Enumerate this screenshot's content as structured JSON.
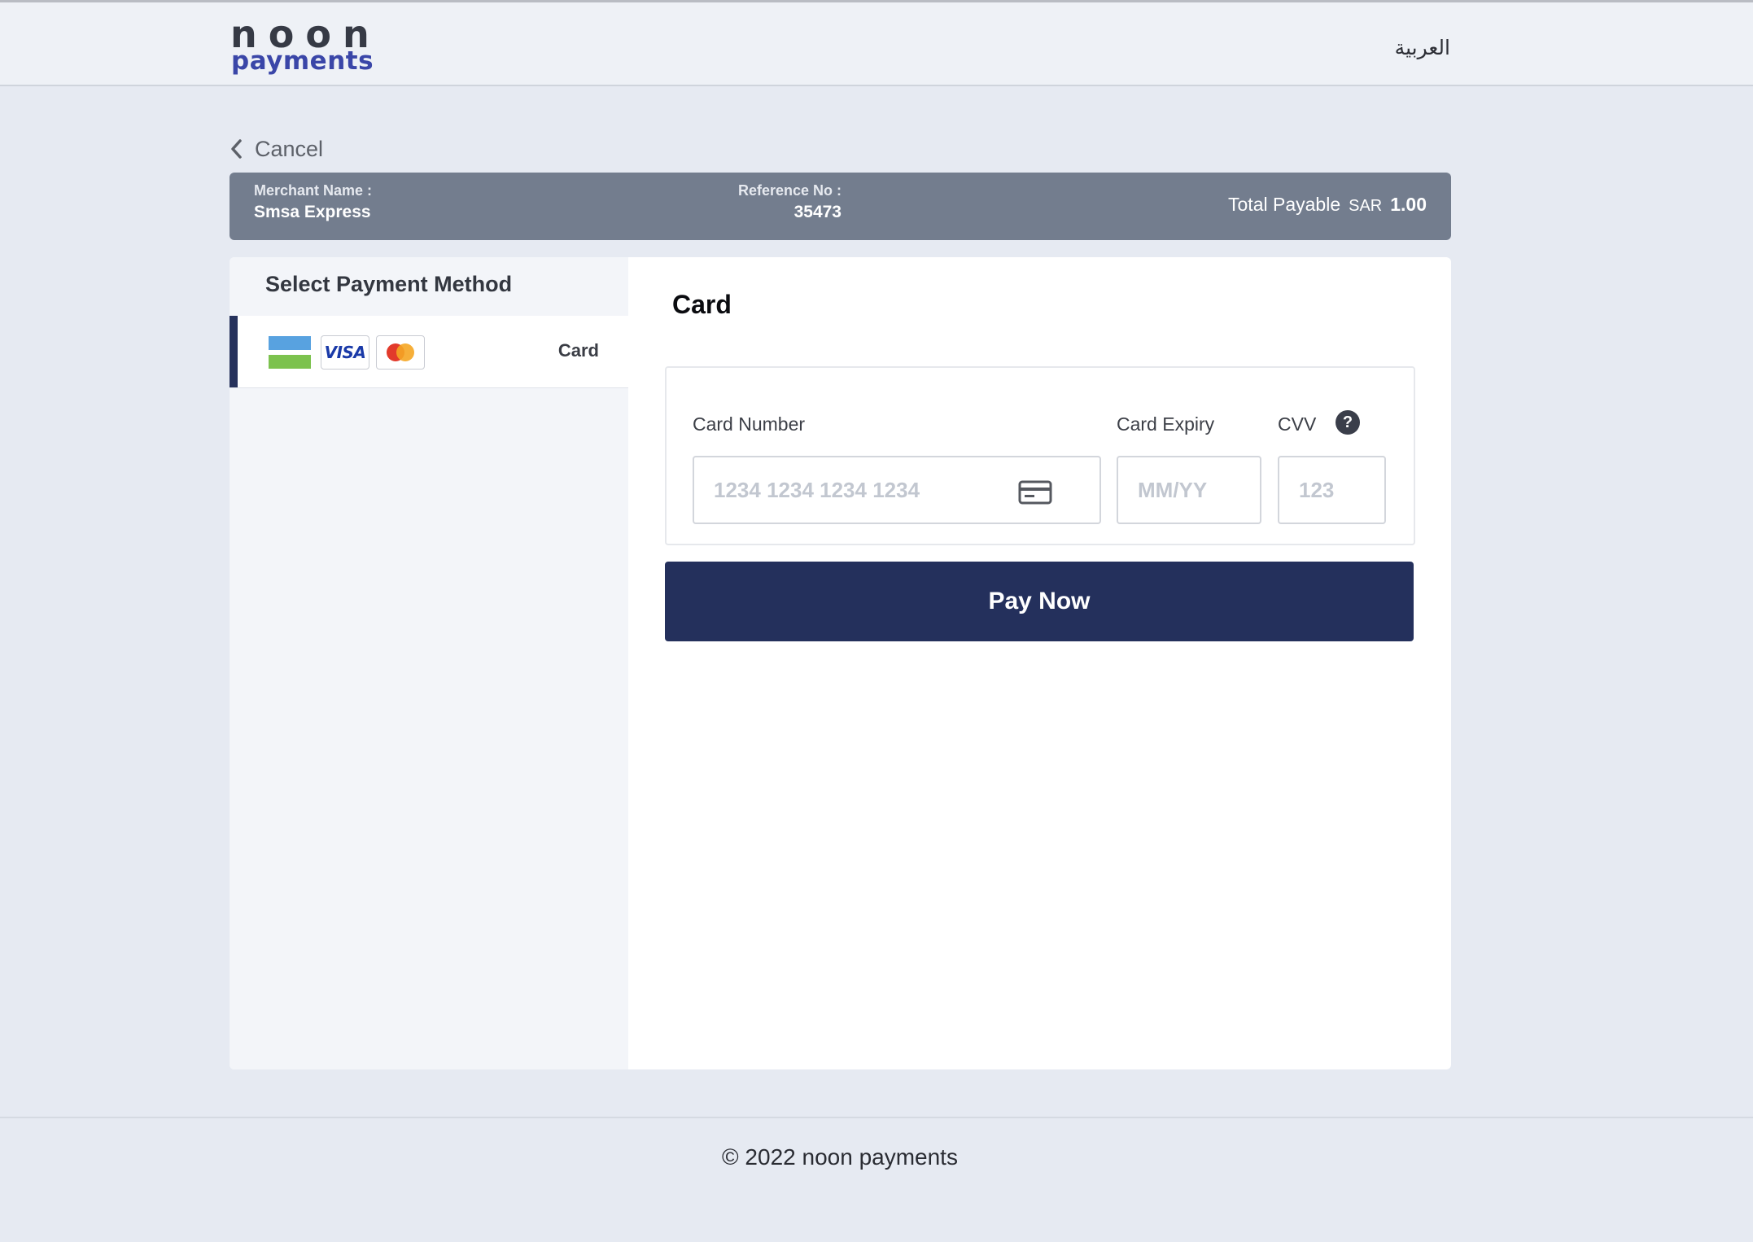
{
  "header": {
    "logo_line1": "noon",
    "logo_line2": "payments",
    "language_link": "العربية"
  },
  "nav": {
    "cancel_label": "Cancel"
  },
  "summary": {
    "merchant_label": "Merchant Name :",
    "merchant_name": "Smsa Express",
    "reference_label": "Reference No :",
    "reference_no": "35473",
    "total_label": "Total Payable",
    "currency": "SAR",
    "amount": "1.00"
  },
  "sidebar": {
    "title": "Select Payment Method",
    "methods": [
      {
        "label": "Card",
        "icons": [
          "generic-card-icon",
          "visa-icon",
          "mastercard-icon"
        ],
        "visa_text": "VISA",
        "selected": true
      }
    ]
  },
  "card_form": {
    "title": "Card",
    "card_number_label": "Card Number",
    "card_number_placeholder": "1234 1234 1234 1234",
    "expiry_label": "Card Expiry",
    "expiry_placeholder": "MM/YY",
    "cvv_label": "CVV",
    "cvv_placeholder": "123",
    "cvv_help": "?",
    "pay_button": "Pay Now"
  },
  "footer": {
    "copyright": "© 2022 noon payments"
  },
  "colors": {
    "primary": "#24305c",
    "summary_bar": "#737d8e",
    "brand_blue": "#3a46a8",
    "page_bg": "#e6eaf2"
  }
}
